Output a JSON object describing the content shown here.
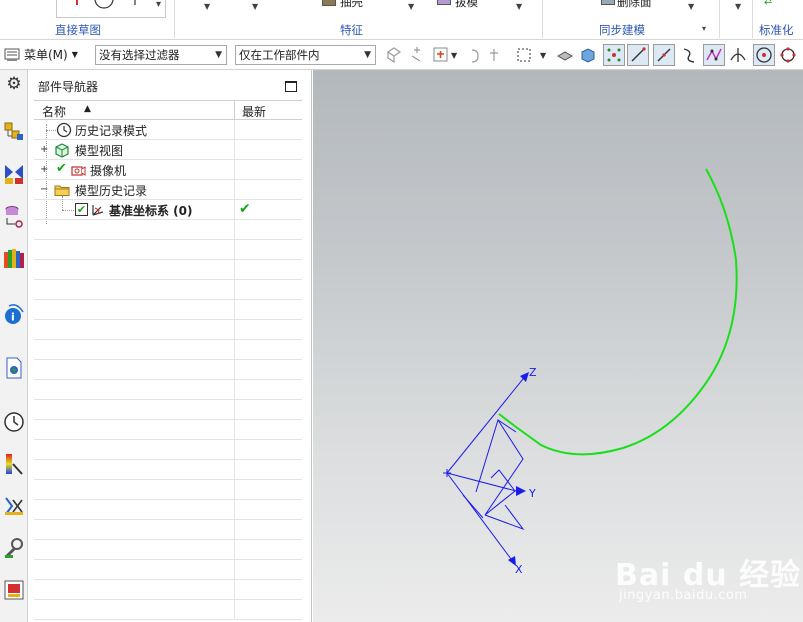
{
  "ribbon": {
    "groups": [
      "直接草图",
      "特征",
      "同步建模",
      "标准化工"
    ],
    "partial_items": [
      "抽壳",
      "拔模",
      "删除面"
    ]
  },
  "toolbar": {
    "menu_label": "菜单(M)",
    "filter_value": "没有选择过滤器",
    "scope_value": "仅在工作部件内"
  },
  "navigator": {
    "title": "部件导航器",
    "columns": {
      "name": "名称",
      "latest": "最新"
    },
    "rows": [
      {
        "label": "历史记录模式",
        "icon": "clock-icon",
        "expander": ""
      },
      {
        "label": "模型视图",
        "icon": "model-view-icon",
        "expander": "+"
      },
      {
        "label": "摄像机",
        "icon": "camera-icon",
        "expander": "+"
      },
      {
        "label": "模型历史记录",
        "icon": "folder-icon",
        "expander": "−"
      },
      {
        "label": "基准坐标系 (0)",
        "icon": "datum-csys-icon",
        "expander": "",
        "latest": "✔"
      }
    ]
  },
  "viewport": {
    "axis_labels": {
      "z": "Z",
      "y": "Y",
      "x": "X"
    },
    "curve_color": "#18e018",
    "csys_color": "#1a1aee"
  },
  "watermark": {
    "brand": "Bai du 经验",
    "url": "jingyan.baidu.com"
  }
}
